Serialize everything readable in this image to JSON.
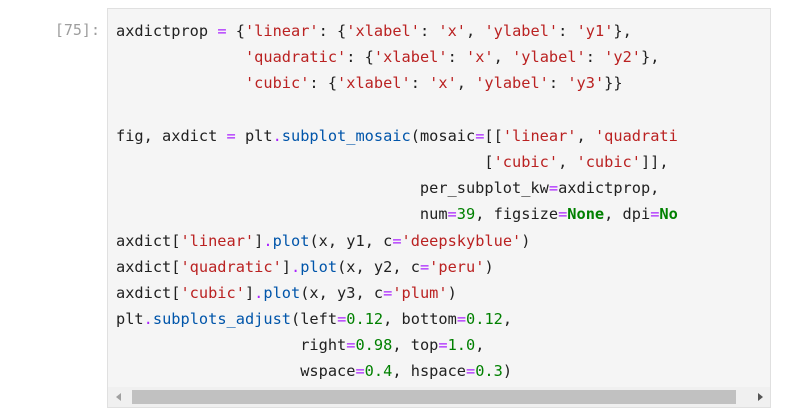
{
  "cell": {
    "prompt": "[75]:",
    "lines": [
      [
        [
          "p",
          "axdictprop "
        ],
        [
          "o",
          "="
        ],
        [
          "p",
          " {"
        ],
        [
          "s",
          "'linear'"
        ],
        [
          "p",
          ": {"
        ],
        [
          "s",
          "'xlabel'"
        ],
        [
          "p",
          ": "
        ],
        [
          "s",
          "'x'"
        ],
        [
          "p",
          ", "
        ],
        [
          "s",
          "'ylabel'"
        ],
        [
          "p",
          ": "
        ],
        [
          "s",
          "'y1'"
        ],
        [
          "p",
          "},"
        ]
      ],
      [
        [
          "p",
          "              "
        ],
        [
          "s",
          "'quadratic'"
        ],
        [
          "p",
          ": {"
        ],
        [
          "s",
          "'xlabel'"
        ],
        [
          "p",
          ": "
        ],
        [
          "s",
          "'x'"
        ],
        [
          "p",
          ", "
        ],
        [
          "s",
          "'ylabel'"
        ],
        [
          "p",
          ": "
        ],
        [
          "s",
          "'y2'"
        ],
        [
          "p",
          "},"
        ]
      ],
      [
        [
          "p",
          "              "
        ],
        [
          "s",
          "'cubic'"
        ],
        [
          "p",
          ": {"
        ],
        [
          "s",
          "'xlabel'"
        ],
        [
          "p",
          ": "
        ],
        [
          "s",
          "'x'"
        ],
        [
          "p",
          ", "
        ],
        [
          "s",
          "'ylabel'"
        ],
        [
          "p",
          ": "
        ],
        [
          "s",
          "'y3'"
        ],
        [
          "p",
          "}}"
        ]
      ],
      [],
      [
        [
          "p",
          "fig, axdict "
        ],
        [
          "o",
          "="
        ],
        [
          "p",
          " plt"
        ],
        [
          "o",
          "."
        ],
        [
          "f",
          "subplot_mosaic"
        ],
        [
          "p",
          "(mosaic"
        ],
        [
          "o",
          "="
        ],
        [
          "p",
          "[["
        ],
        [
          "s",
          "'linear'"
        ],
        [
          "p",
          ", "
        ],
        [
          "s",
          "'quadrati"
        ]
      ],
      [
        [
          "p",
          "                                        ["
        ],
        [
          "s",
          "'cubic'"
        ],
        [
          "p",
          ", "
        ],
        [
          "s",
          "'cubic'"
        ],
        [
          "p",
          "]],"
        ]
      ],
      [
        [
          "p",
          "                                 per_subplot_kw"
        ],
        [
          "o",
          "="
        ],
        [
          "p",
          "axdictprop,"
        ]
      ],
      [
        [
          "p",
          "                                 num"
        ],
        [
          "o",
          "="
        ],
        [
          "num",
          "39"
        ],
        [
          "p",
          ", figsize"
        ],
        [
          "o",
          "="
        ],
        [
          "n",
          "None"
        ],
        [
          "p",
          ", dpi"
        ],
        [
          "o",
          "="
        ],
        [
          "n",
          "No"
        ]
      ],
      [
        [
          "p",
          "axdict["
        ],
        [
          "s",
          "'linear'"
        ],
        [
          "p",
          "]"
        ],
        [
          "o",
          "."
        ],
        [
          "f",
          "plot"
        ],
        [
          "p",
          "(x, y1, c"
        ],
        [
          "o",
          "="
        ],
        [
          "s",
          "'deepskyblue'"
        ],
        [
          "p",
          ")"
        ]
      ],
      [
        [
          "p",
          "axdict["
        ],
        [
          "s",
          "'quadratic'"
        ],
        [
          "p",
          "]"
        ],
        [
          "o",
          "."
        ],
        [
          "f",
          "plot"
        ],
        [
          "p",
          "(x, y2, c"
        ],
        [
          "o",
          "="
        ],
        [
          "s",
          "'peru'"
        ],
        [
          "p",
          ")"
        ]
      ],
      [
        [
          "p",
          "axdict["
        ],
        [
          "s",
          "'cubic'"
        ],
        [
          "p",
          "]"
        ],
        [
          "o",
          "."
        ],
        [
          "f",
          "plot"
        ],
        [
          "p",
          "(x, y3, c"
        ],
        [
          "o",
          "="
        ],
        [
          "s",
          "'plum'"
        ],
        [
          "p",
          ")"
        ]
      ],
      [
        [
          "p",
          "plt"
        ],
        [
          "o",
          "."
        ],
        [
          "f",
          "subplots_adjust"
        ],
        [
          "p",
          "(left"
        ],
        [
          "o",
          "="
        ],
        [
          "num",
          "0.12"
        ],
        [
          "p",
          ", bottom"
        ],
        [
          "o",
          "="
        ],
        [
          "num",
          "0.12"
        ],
        [
          "p",
          ","
        ]
      ],
      [
        [
          "p",
          "                    right"
        ],
        [
          "o",
          "="
        ],
        [
          "num",
          "0.98"
        ],
        [
          "p",
          ", top"
        ],
        [
          "o",
          "="
        ],
        [
          "num",
          "1.0"
        ],
        [
          "p",
          ","
        ]
      ],
      [
        [
          "p",
          "                    wspace"
        ],
        [
          "o",
          "="
        ],
        [
          "num",
          "0.4"
        ],
        [
          "p",
          ", hspace"
        ],
        [
          "o",
          "="
        ],
        [
          "num",
          "0.3"
        ],
        [
          "p",
          ")"
        ]
      ]
    ]
  },
  "colors": {
    "string": "#ba2121",
    "operator": "#aa22ff",
    "keyword": "#008000",
    "number": "#008000",
    "function": "#0055aa",
    "editor_bg": "#f5f5f5",
    "prompt": "#9e9e9e"
  },
  "scrollbar": {
    "left_arrow_icon": "triangle-left-icon",
    "right_arrow_icon": "triangle-right-icon"
  }
}
